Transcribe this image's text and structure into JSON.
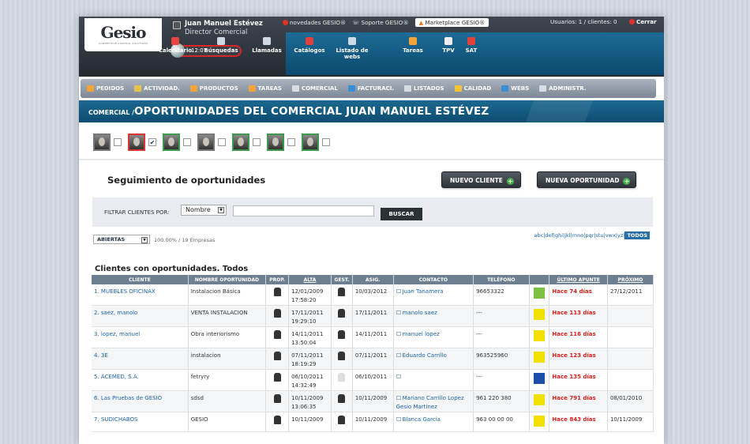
{
  "header": {
    "logo": "Gesio",
    "logo_sub": "COMPETITIVE CONTROL SOLUTIONS",
    "user_name": "Juan Manuel Estévez",
    "user_role": "Director Comercial",
    "clock": "12:07",
    "links": [
      "novedades GESIO®",
      "Soporte GESIO®",
      "Marketplace GESIO®"
    ],
    "usuarios": "Usuarios: 1 / clientes: 0",
    "cerrar": "Cerrar"
  },
  "quickbar": [
    {
      "label": "Calendario",
      "icon": "calendar-icon",
      "color": "#e8463f"
    },
    {
      "label": "Búsquedas",
      "icon": "search-icon",
      "color": "#cfd9e4"
    },
    {
      "label": "Llamadas",
      "icon": "phone-icon",
      "color": "#cfd9e4"
    },
    {
      "label": "Catálogos",
      "icon": "catalog-icon",
      "color": "#e0413a"
    },
    {
      "label": "Listado de webs",
      "icon": "web-list-icon",
      "color": "#cfd9e4"
    },
    {
      "label": "Tareas",
      "icon": "tasks-icon",
      "color": "#f2a33a"
    },
    {
      "label": "TPV",
      "icon": "tpv-icon",
      "color": "#eee"
    },
    {
      "label": "SAT",
      "icon": "sat-icon",
      "color": "#e0413a"
    }
  ],
  "menu": [
    {
      "label": "PEDIDOS",
      "color": "#f2a33a"
    },
    {
      "label": "ACTIVIDAD.",
      "color": "#e6c34a"
    },
    {
      "label": "PRODUCTOS",
      "color": "#f2a33a"
    },
    {
      "label": "TAREAS",
      "color": "#f2a33a"
    },
    {
      "label": "COMERCIAL",
      "color": "#d8dde4"
    },
    {
      "label": "FACTURACI.",
      "color": "#3b8fd6"
    },
    {
      "label": "LISTADOS",
      "color": "#d8dde4"
    },
    {
      "label": "CALIDAD",
      "color": "#f2c536"
    },
    {
      "label": "WEBS",
      "color": "#3b8fd6"
    },
    {
      "label": "ADMINISTR.",
      "color": "#d8dde4"
    }
  ],
  "band": {
    "breadcrumb": "COMERCIAL /",
    "title": "OPORTUNIDADES DEL COMERCIAL JUAN MANUEL ESTÉVEZ"
  },
  "people": [
    {
      "checked": false,
      "border": "#777"
    },
    {
      "checked": true,
      "border": "#d33"
    },
    {
      "checked": false,
      "border": "#3a9a4a"
    },
    {
      "checked": false,
      "border": "#777"
    },
    {
      "checked": false,
      "border": "#3a9a4a"
    },
    {
      "checked": false,
      "border": "#3a9a4a"
    },
    {
      "checked": false,
      "border": "#3a9a4a"
    }
  ],
  "section": {
    "title": "Seguimiento de oportunidades",
    "new_client": "NUEVO CLIENTE",
    "new_opp": "NUEVA OPORTUNIDAD"
  },
  "filter": {
    "label": "FILTRAR CLIENTES POR:",
    "select": "Nombre",
    "search_value": "",
    "button": "BUSCAR"
  },
  "status": {
    "select": "ABIERTAS",
    "summary": "100.00% / 19 Empresas",
    "alpha": "abc|def|ghi|jkl|mno|pqr|stu|vwx|yz|",
    "todos": "TODOS"
  },
  "table": {
    "title": "Clientes con oportunidades. Todos",
    "headers": [
      "CLIENTE",
      "NOMBRE OPORTUNIDAD",
      "PROP.",
      "ALTA",
      "GEST.",
      "ASIG.",
      "CONTACTO",
      "TELÉFONO",
      "",
      "ÚLTIMO APUNTE",
      "PRÓXIMO"
    ],
    "rows": [
      {
        "cliente": "1. MUEBLES OFICINAX",
        "op": "Instalacion Básica",
        "alta1": "12/01/2009",
        "alta2": "17:58:20",
        "asig": "10/03/2012",
        "contacto": "Juan Tanamera",
        "contacto2": "",
        "tel": "96653322",
        "color": "#7dc142",
        "ultimo": "Hace 74 días",
        "proximo": "27/12/2011"
      },
      {
        "cliente": "2. saez, manolo",
        "op": "VENTA INSTALACION",
        "alta1": "17/11/2011",
        "alta2": "19:29:10",
        "asig": "17/11/2011",
        "contacto": "manolo saez",
        "contacto2": "",
        "tel": "---",
        "color": "#f2e100",
        "ultimo": "Hace 113 días",
        "proximo": ""
      },
      {
        "cliente": "3. lopez, manuel",
        "op": "Obra interiorismo",
        "alta1": "14/11/2011",
        "alta2": "13:50:04",
        "asig": "14/11/2011",
        "contacto": "manuel lopez",
        "contacto2": "",
        "tel": "---",
        "color": "#f2e100",
        "ultimo": "Hace 116 días",
        "proximo": ""
      },
      {
        "cliente": "4. 3E",
        "op": "instalacion",
        "alta1": "07/11/2011",
        "alta2": "18:19:29",
        "asig": "07/11/2011",
        "contacto": "Eduardo Carrillo",
        "contacto2": "",
        "tel": "963525960",
        "color": "#f2e100",
        "ultimo": "Hace 123 días",
        "proximo": ""
      },
      {
        "cliente": "5. ACEMED, S.A.",
        "op": "fetryry",
        "alta1": "06/10/2011",
        "alta2": "14:32:49",
        "asig": "06/10/2011",
        "contacto": "",
        "contacto2": "",
        "tel": "---",
        "color": "#1d4ea8",
        "ultimo": "Hace 135 días",
        "proximo": ""
      },
      {
        "cliente": "6. Las Pruebas de GESIO",
        "op": "sdsd",
        "alta1": "10/11/2009",
        "alta2": "13:06:35",
        "asig": "10/11/2009",
        "contacto": "Mariano Carrillo Lopez",
        "contacto2": "Gesio Martinez",
        "tel": "961 220 380",
        "color": "#f2e100",
        "ultimo": "Hace 791 días",
        "proximo": "08/01/2010"
      },
      {
        "cliente": "7. SUDICHABOS",
        "op": "GESIO",
        "alta1": "10/11/2009",
        "alta2": "",
        "asig": "10/11/2009",
        "contacto": "Blanca Garcia",
        "contacto2": "",
        "tel": "963 00 00 00",
        "color": "#f2e100",
        "ultimo": "Hace 843 días",
        "proximo": "10/11/2009"
      }
    ]
  }
}
